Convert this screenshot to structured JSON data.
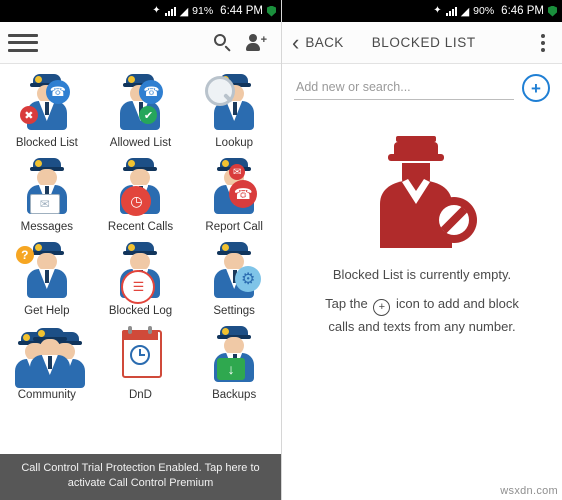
{
  "left": {
    "status_bar": {
      "icons": [
        "bluetooth-icon",
        "wifi-icon",
        "signal-icon"
      ],
      "battery": "91%",
      "time": "6:44 PM",
      "shield": "shield-icon"
    },
    "action_bar": {
      "menu": "hamburger-icon",
      "search": "search-icon",
      "add_contact": "person-add-icon",
      "overflow": "overflow-menu-icon"
    },
    "grid": [
      {
        "label": "Blocked List",
        "icon": "officer-block-phone-icon"
      },
      {
        "label": "Allowed List",
        "icon": "officer-allow-phone-icon"
      },
      {
        "label": "Lookup",
        "icon": "officer-magnifier-icon"
      },
      {
        "label": "Messages",
        "icon": "officer-envelope-icon"
      },
      {
        "label": "Recent Calls",
        "icon": "officer-clock-icon"
      },
      {
        "label": "Report Call",
        "icon": "officer-report-phone-icon"
      },
      {
        "label": "Get Help",
        "icon": "officer-question-icon"
      },
      {
        "label": "Blocked Log",
        "icon": "officer-log-icon"
      },
      {
        "label": "Settings",
        "icon": "officer-gear-icon"
      },
      {
        "label": "Community",
        "icon": "officers-group-icon"
      },
      {
        "label": "DnD",
        "icon": "calendar-clock-icon"
      },
      {
        "label": "Backups",
        "icon": "officer-download-icon"
      }
    ],
    "toast": "Call Control Trial Protection Enabled. Tap here to activate Call Control Premium"
  },
  "right": {
    "status_bar": {
      "icons": [
        "bluetooth-icon",
        "wifi-icon",
        "signal-icon"
      ],
      "battery": "90%",
      "time": "6:46 PM",
      "shield": "shield-icon"
    },
    "action_bar": {
      "back_label": "BACK",
      "title": "BLOCKED LIST",
      "overflow": "overflow-menu-icon"
    },
    "search": {
      "placeholder": "Add new or search...",
      "value": "",
      "add_button": "add-circle-icon"
    },
    "empty_state": {
      "illustration": "blocked-officer-icon",
      "line1": "Blocked List is currently empty.",
      "line2_before": "Tap the",
      "line2_after": "icon to add and block",
      "line3": "calls and texts from any number."
    },
    "watermark": "wsxdn.com"
  },
  "colors": {
    "accent_blue": "#1f7fd4",
    "brand_red": "#b02b2b",
    "uniform_blue": "#2b6cb0",
    "toast_bg": "#404040"
  }
}
